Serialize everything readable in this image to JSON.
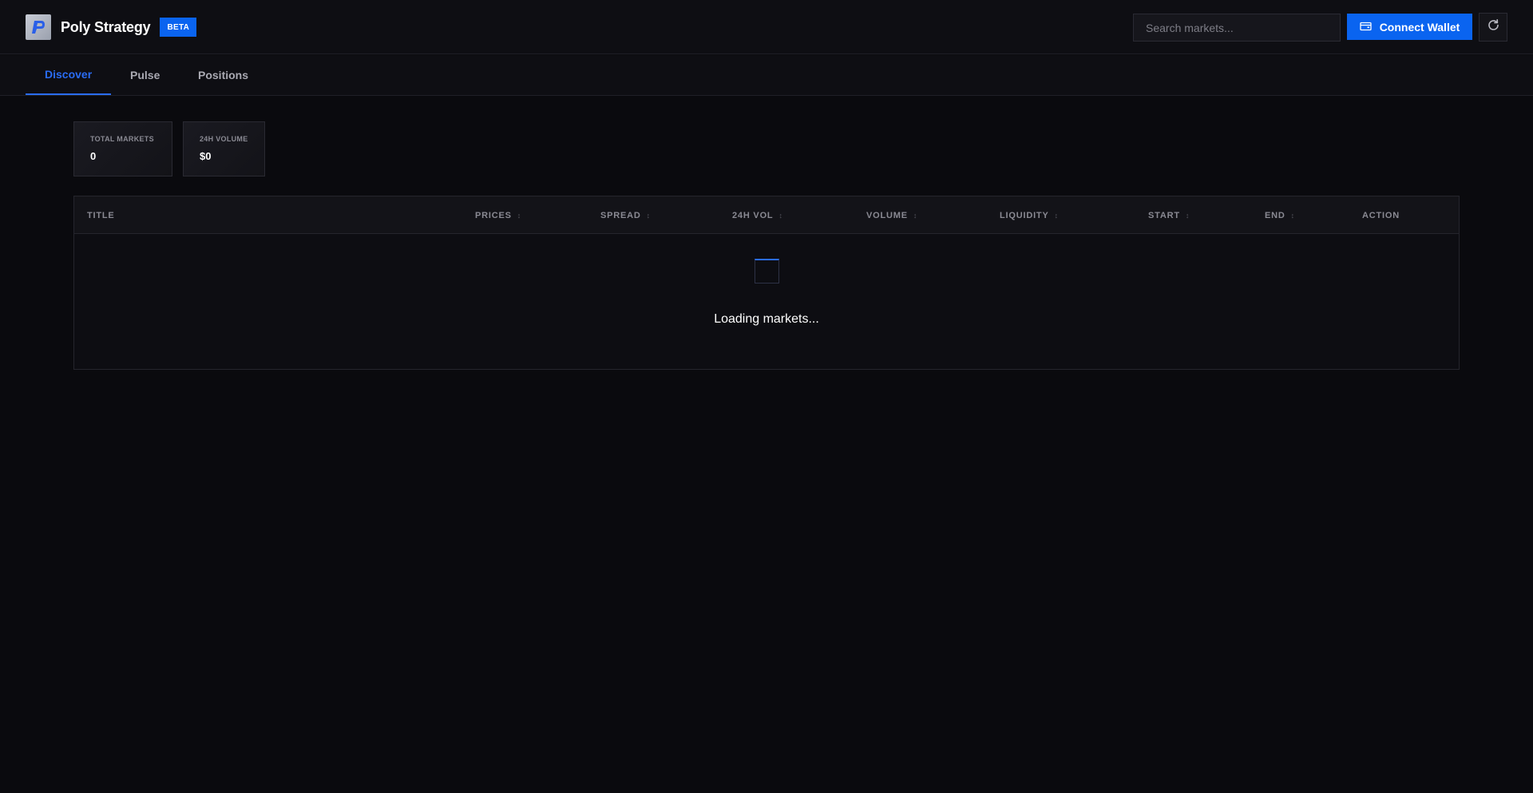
{
  "header": {
    "brand_name": "Poly Strategy",
    "badge": "BETA",
    "search_placeholder": "Search markets...",
    "connect_label": "Connect Wallet",
    "accent_color": "#0a64f0"
  },
  "tabs": [
    {
      "label": "Discover",
      "active": true
    },
    {
      "label": "Pulse",
      "active": false
    },
    {
      "label": "Positions",
      "active": false
    }
  ],
  "stats": [
    {
      "label": "TOTAL MARKETS",
      "value": "0"
    },
    {
      "label": "24H VOLUME",
      "value": "$0"
    }
  ],
  "table": {
    "columns": [
      {
        "label": "TITLE",
        "sortable": false
      },
      {
        "label": "PRICES",
        "sortable": true
      },
      {
        "label": "SPREAD",
        "sortable": true
      },
      {
        "label": "24H VOL",
        "sortable": true
      },
      {
        "label": "VOLUME",
        "sortable": true
      },
      {
        "label": "LIQUIDITY",
        "sortable": true
      },
      {
        "label": "START",
        "sortable": true
      },
      {
        "label": "END",
        "sortable": true
      },
      {
        "label": "ACTION",
        "sortable": false
      }
    ],
    "sort_icon": "↕",
    "loading_text": "Loading markets..."
  },
  "icons": {
    "logo": "polymarket-p-logo",
    "wallet": "wallet-icon",
    "refresh": "refresh-icon"
  }
}
